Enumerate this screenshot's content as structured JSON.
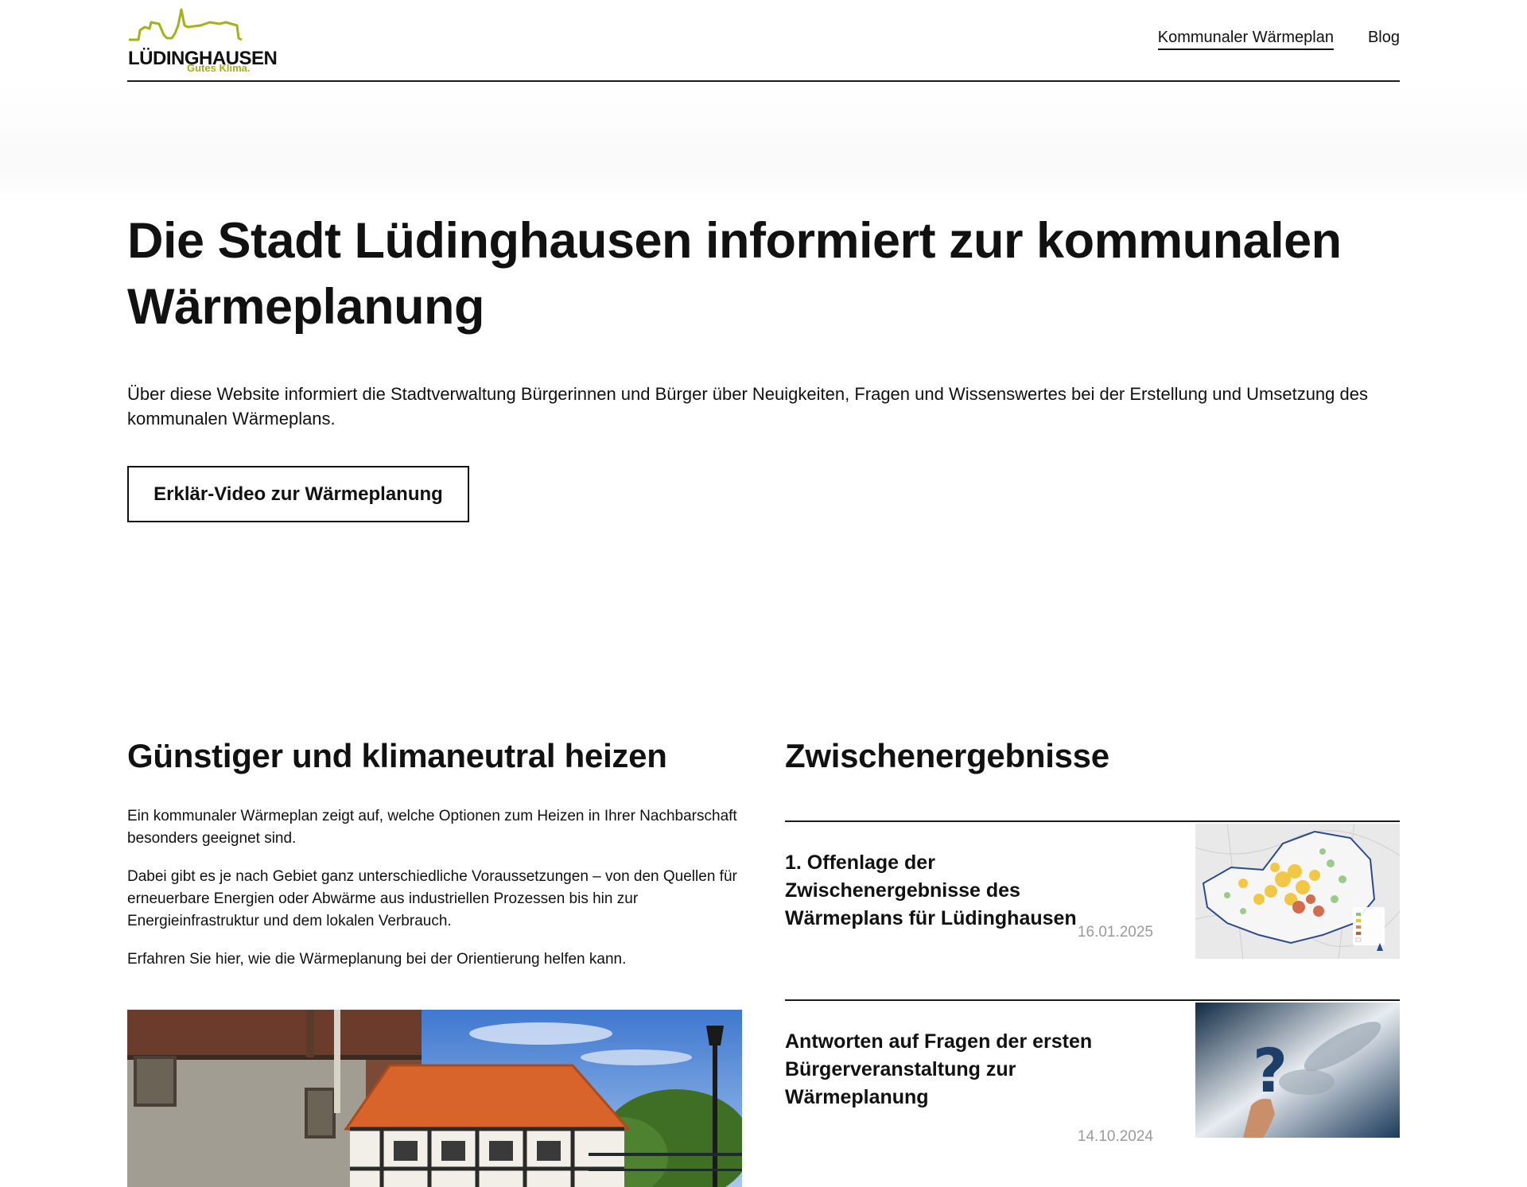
{
  "brand": {
    "name": "LÜDINGHAUSEN",
    "tagline": "Gutes Klima.",
    "accent_color": "#a4b118"
  },
  "nav": {
    "items": [
      {
        "label": "Kommunaler Wärmeplan",
        "active": true
      },
      {
        "label": "Blog",
        "active": false
      }
    ]
  },
  "hero": {
    "title": "Die Stadt Lüdinghausen informiert zur kommunalen Wärmeplanung",
    "text": "Über diese Website informiert die Stadtverwaltung Bürgerinnen und Bürger über Neuigkeiten, Fragen und Wissenswertes bei der Erstellung und Umsetzung des kommunalen Wärmeplans.",
    "button_label": "Erklär-Video zur Wärmeplanung"
  },
  "left": {
    "title": "Günstiger und klimaneutral heizen",
    "paragraphs": [
      "Ein kommunaler Wärmeplan zeigt auf, welche Optionen zum Heizen in Ihrer Nachbarschaft besonders geeignet sind.",
      "Dabei gibt es je nach Gebiet ganz unterschiedliche Voraussetzungen – von den Quellen für erneuerbare Energien oder Abwärme aus industriellen Prozessen bis hin zur Energieinfrastruktur und dem lokalen Verbrauch.",
      "Erfahren Sie hier, wie die Wärmeplanung bei der Orientierung helfen kann."
    ]
  },
  "right": {
    "title": "Zwischenergebnisse",
    "posts": [
      {
        "title": "1. Offenlage der Zwischenergebnisse des Wärmeplans für Lüdinghausen",
        "date": "16.01.2025",
        "thumb_icon": "heat-map-thumbnail"
      },
      {
        "title": "Antworten auf Fragen der ersten Bürgerveranstaltung zur Wärmeplanung",
        "date": "14.10.2024",
        "thumb_icon": "question-mark-thumbnail"
      }
    ]
  }
}
